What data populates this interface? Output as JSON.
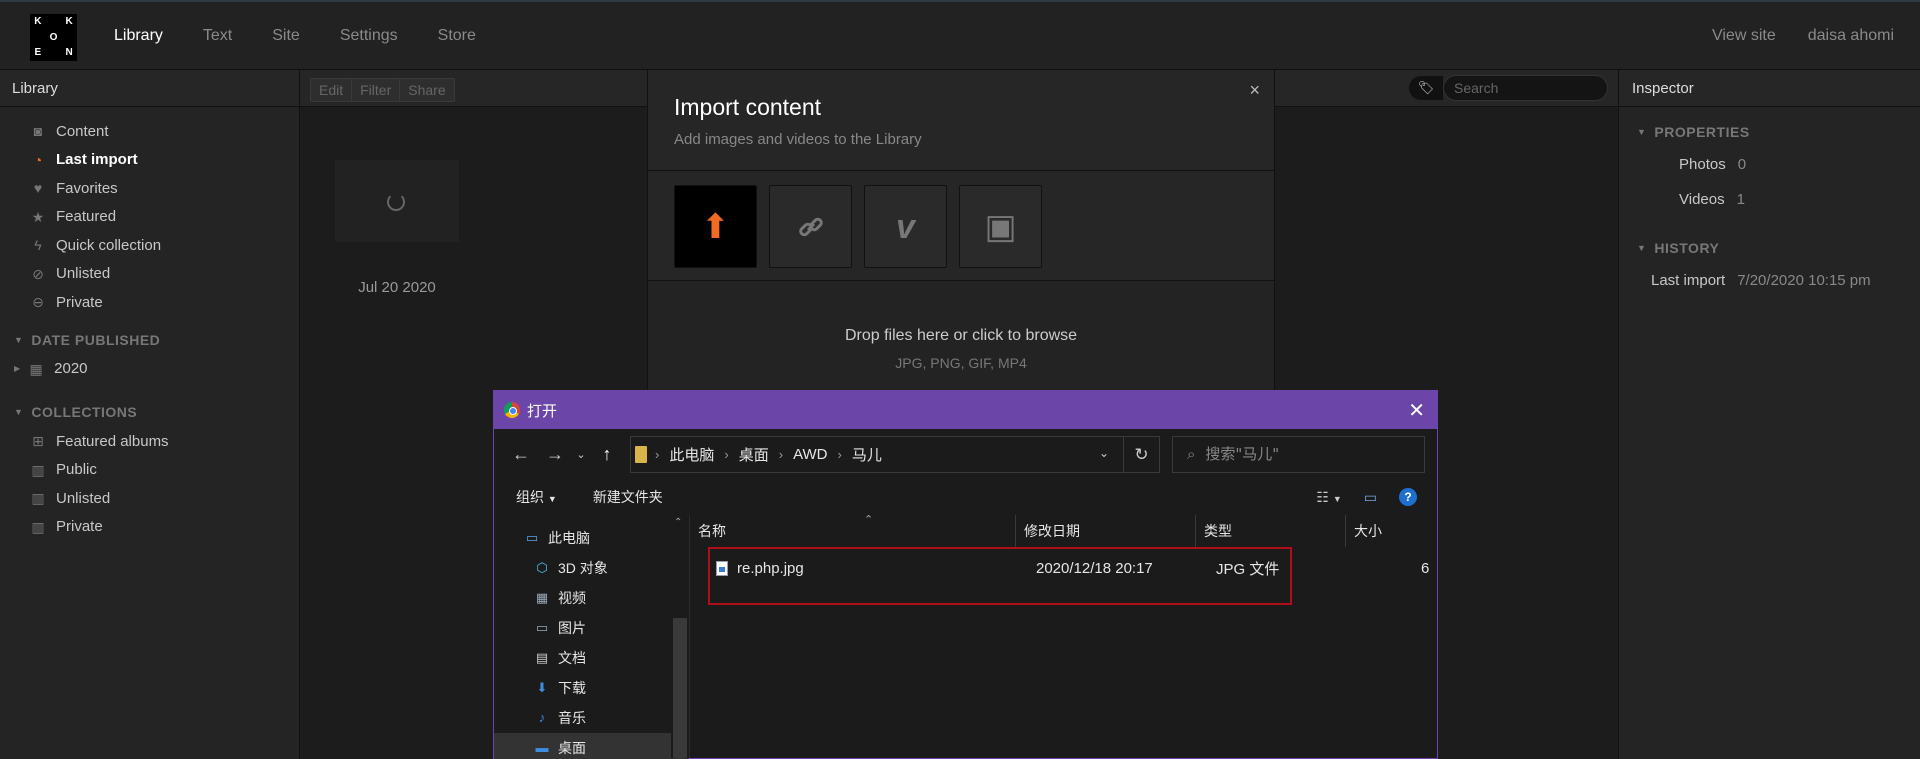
{
  "app": {
    "logo_letters": [
      "K",
      "",
      "K",
      "",
      "O",
      "",
      "E",
      "",
      "N"
    ],
    "nav": [
      {
        "label": "Library",
        "active": true
      },
      {
        "label": "Text",
        "active": false
      },
      {
        "label": "Site",
        "active": false
      },
      {
        "label": "Settings",
        "active": false
      },
      {
        "label": "Store",
        "active": false
      }
    ],
    "view_site": "View site",
    "user": "daisa ahomi"
  },
  "sidebar": {
    "title": "Library",
    "items": [
      {
        "label": "Content",
        "icon": "camera-icon"
      },
      {
        "label": "Last import",
        "icon": "clock-icon",
        "active": true
      },
      {
        "label": "Favorites",
        "icon": "heart-icon"
      },
      {
        "label": "Featured",
        "icon": "star-icon"
      },
      {
        "label": "Quick collection",
        "icon": "lightning-icon"
      },
      {
        "label": "Unlisted",
        "icon": "hidden-eye-icon"
      },
      {
        "label": "Private",
        "icon": "private-icon"
      }
    ],
    "date_section": "DATE PUBLISHED",
    "date_items": [
      {
        "label": "2020",
        "icon": "calendar-icon"
      }
    ],
    "collections_section": "COLLECTIONS",
    "collection_items": [
      {
        "label": "Featured albums",
        "icon": "featured-album-icon"
      },
      {
        "label": "Public",
        "icon": "album-icon"
      },
      {
        "label": "Unlisted",
        "icon": "album-icon"
      },
      {
        "label": "Private",
        "icon": "album-icon"
      }
    ]
  },
  "toolbar": {
    "edit": "Edit",
    "filter": "Filter",
    "share": "Share",
    "search_placeholder": "Search"
  },
  "library": {
    "thumb_date": "Jul 20 2020"
  },
  "import_modal": {
    "title": "Import content",
    "subtitle": "Add images and videos to the Library",
    "close": "×",
    "sources": [
      {
        "icon": "upload-icon",
        "glyph": "⬆",
        "active": true
      },
      {
        "icon": "link-icon",
        "glyph": "🔗",
        "active": false
      },
      {
        "icon": "vimeo-icon",
        "glyph": "v",
        "active": false
      },
      {
        "icon": "instagram-icon",
        "glyph": "▣",
        "active": false
      }
    ],
    "drop_main": "Drop files here or click to browse",
    "drop_sub": "JPG, PNG, GIF, MP4"
  },
  "inspector": {
    "title": "Inspector",
    "properties_section": "PROPERTIES",
    "photos_label": "Photos",
    "photos_value": "0",
    "videos_label": "Videos",
    "videos_value": "1",
    "history_section": "HISTORY",
    "last_import_label": "Last import",
    "last_import_value": "7/20/2020 10:15 pm"
  },
  "file_dialog": {
    "title": "打开",
    "close": "✕",
    "breadcrumb": [
      "此电脑",
      "桌面",
      "AWD",
      "马儿"
    ],
    "search_placeholder": "搜索\"马儿\"",
    "organize": "组织",
    "new_folder": "新建文件夹",
    "tree": [
      {
        "label": "此电脑",
        "icon": "computer-icon",
        "glyph": "💻",
        "root": true
      },
      {
        "label": "3D 对象",
        "icon": "3d-objects-icon",
        "glyph": "⬡"
      },
      {
        "label": "视频",
        "icon": "video-folder-icon",
        "glyph": "▦"
      },
      {
        "label": "图片",
        "icon": "pictures-folder-icon",
        "glyph": "▭"
      },
      {
        "label": "文档",
        "icon": "documents-folder-icon",
        "glyph": "▤"
      },
      {
        "label": "下载",
        "icon": "download-folder-icon",
        "glyph": "⬇"
      },
      {
        "label": "音乐",
        "icon": "music-folder-icon",
        "glyph": "♪"
      },
      {
        "label": "桌面",
        "icon": "desktop-folder-icon",
        "glyph": "▬",
        "selected": true
      }
    ],
    "columns": [
      "名称",
      "修改日期",
      "类型",
      "大小"
    ],
    "files": [
      {
        "name": "re.php.jpg",
        "modified": "2020/12/18 20:17",
        "type": "JPG 文件",
        "size": "6"
      }
    ]
  },
  "colors": {
    "accent_orange": "#f26b22",
    "dialog_purple": "#6b46a8",
    "highlight_red": "#b0101a"
  }
}
